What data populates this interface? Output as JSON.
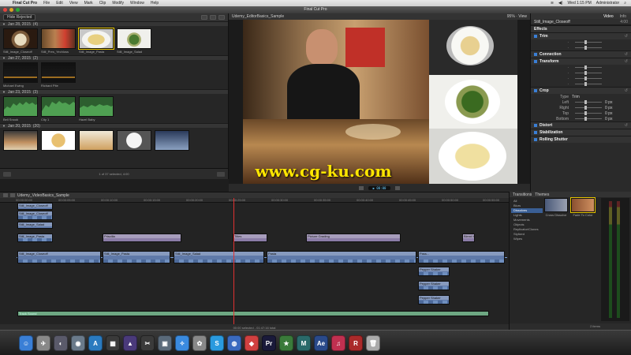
{
  "menubar": {
    "items": [
      "Final Cut Pro",
      "File",
      "Edit",
      "View",
      "Mark",
      "Clip",
      "Modify",
      "Window",
      "Help"
    ],
    "clock": "Wed 1:15 PM",
    "user": "Administrator"
  },
  "window": {
    "title": "Final Cut Pro"
  },
  "browser": {
    "filter": "Hide Rejected",
    "events": [
      {
        "date": "Jan 28, 2015",
        "count": "(4)",
        "clips": [
          "Still_Image_Closeoff",
          "Still_Pres_Yechloss",
          "Still_Image_Pasta",
          "Still_Image_Salad"
        ]
      },
      {
        "date": "Jan 27, 2015",
        "count": "(2)",
        "clips": [
          "Michael Ewing",
          "Richard Pite"
        ]
      },
      {
        "date": "Jan 23, 2015",
        "count": "(3)",
        "clips": [
          "Bell Snook",
          "City 1",
          "Hazel Baby"
        ]
      },
      {
        "date": "Jan 20, 2015",
        "count": "(20)",
        "clips": [
          "",
          "",
          "",
          "",
          ""
        ]
      }
    ],
    "status": "1 of 37 selected, 4:00"
  },
  "viewer": {
    "title": "Udemy_EditorBasics_Sample",
    "zoom": "95%",
    "menu": "View"
  },
  "inspector": {
    "tabs": [
      "Video",
      "Info"
    ],
    "clip_name": "Still_Image_Closeoff",
    "duration": "4:00",
    "sections": {
      "effects": "Effects",
      "crop": "Crop",
      "stabilization": "Stabilization",
      "rolling_shutter": "Rolling Shutter"
    },
    "trim": "Trim",
    "connection": "Connection",
    "transform": "Transform",
    "distort": "Distort",
    "type": {
      "label": "Type",
      "value": "Trim"
    },
    "crop_fields": [
      {
        "label": "Left",
        "value": "0 px"
      },
      {
        "label": "Right",
        "value": "0 px"
      },
      {
        "label": "Top",
        "value": "0 px"
      },
      {
        "label": "Bottom",
        "value": "0 px"
      }
    ]
  },
  "timeline": {
    "project": "Udemy_VideoBasics_Sample",
    "footer": "00:00 selected - 01:47:16 total",
    "ruler_ticks": [
      "00:00:00:00",
      "00:00:05:00",
      "00:00:10:00",
      "00:00:15:00",
      "00:00:20:00",
      "00:00:25:00",
      "00:00:30:00",
      "00:00:35:00",
      "00:00:40:00",
      "00:00:45:00",
      "00:00:50:00",
      "00:00:55:00"
    ],
    "connected_clips": [
      "Still_Image_Closeoff",
      "Still_Image_Salad",
      "Still_Image_Pasta",
      "Priscilla",
      "Picture Grading",
      "Blend Mode",
      "Titles",
      "Pasta",
      "Pepper Shaker",
      "Pass..."
    ],
    "storyline_label": "Track Sound"
  },
  "transitions": {
    "tabs": [
      "Transitions",
      "Themes"
    ],
    "categories": [
      "All",
      "Blurs",
      "Dissolves",
      "Lights",
      "Movements",
      "Objects",
      "Replicator/Clones",
      "Stylized",
      "Wipes"
    ],
    "selected_category": "Dissolves",
    "items": [
      "Cross Dissolve",
      "Fade To Color"
    ],
    "count": "2 items"
  },
  "watermark": "www.cg-ku.com",
  "colors": {
    "accent": "#3a7fd6",
    "playhead": "#e03030",
    "watermark": "#ffe600",
    "video_clip": "#5f79a8",
    "audio_clip": "#3e8b5a"
  }
}
